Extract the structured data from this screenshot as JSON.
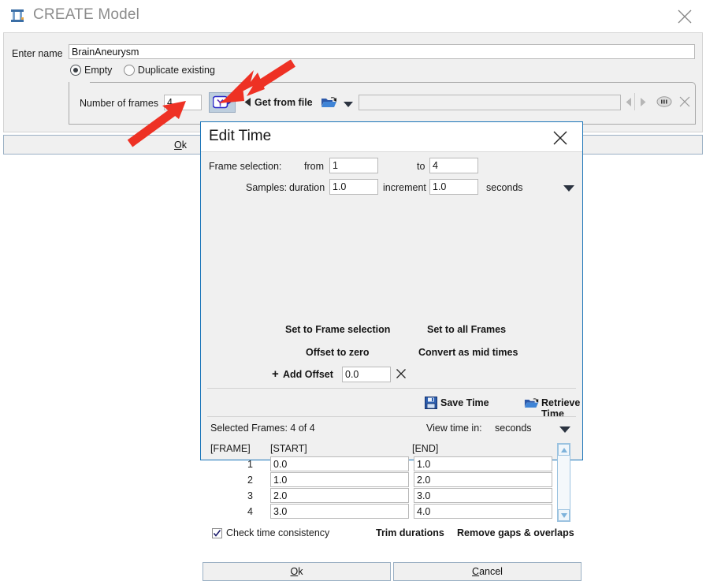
{
  "window": {
    "title": "CREATE Model",
    "icon": "app-table-icon",
    "close_icon": "close-icon"
  },
  "form": {
    "enter_name_label": "Enter name",
    "name_value": "BrainAneurysm",
    "options": [
      {
        "label": "Empty",
        "selected": true
      },
      {
        "label": "Duplicate existing",
        "selected": false
      }
    ],
    "number_of_frames_label": "Number of frames",
    "number_of_frames_value": "4",
    "time_edit_icon": "clock-edit-icon",
    "get_from_file_label": "Get from file",
    "folder_icon": "open-folder-icon",
    "dropdown_icon": "chevron-down-icon",
    "file_value": "",
    "file_placeholder": "",
    "prev_icon": "triangle-left-icon",
    "next_icon": "triangle-right-icon",
    "blob_icon": "ellipsis-button-icon",
    "clear_icon": "close-icon"
  },
  "ok_bar": {
    "label": "Ok",
    "mnemonic": "O"
  },
  "dialog": {
    "title": "Edit Time",
    "close_icon": "close-icon",
    "frame_selection_label": "Frame selection:",
    "from_label": "from",
    "from_value": "1",
    "to_label": "to",
    "to_value": "4",
    "samples_label": "Samples:",
    "duration_label": "duration",
    "duration_value": "1.0",
    "increment_label": "increment",
    "increment_value": "1.0",
    "units_label": "seconds",
    "units_caret_icon": "chevron-down-icon",
    "set_to_frame_selection": "Set to Frame selection",
    "set_to_all_frames": "Set to all Frames",
    "offset_to_zero": "Offset to zero",
    "convert_as_mid_times": "Convert as mid times",
    "add_offset_label": "Add Offset",
    "add_offset_icon": "plus-icon",
    "offset_value": "0.0",
    "offset_clear_icon": "close-icon",
    "save_time_label": "Save Time",
    "save_icon": "floppy-save-icon",
    "retrieve_time_label": "Retrieve Time",
    "retrieve_icon": "open-folder-icon",
    "selected_frames_label": "Selected Frames: 4 of 4",
    "view_time_in_label": "View time in:",
    "view_time_units": "seconds",
    "view_caret_icon": "chevron-down-icon",
    "table": {
      "headers": [
        "[FRAME]",
        "[START]",
        "[END]"
      ],
      "rows": [
        {
          "frame": "1",
          "start": "0.0",
          "end": "1.0"
        },
        {
          "frame": "2",
          "start": "1.0",
          "end": "2.0"
        },
        {
          "frame": "3",
          "start": "2.0",
          "end": "3.0"
        },
        {
          "frame": "4",
          "start": "3.0",
          "end": "4.0"
        }
      ]
    },
    "scroll_up_icon": "triangle-up-icon",
    "scroll_down_icon": "triangle-down-icon",
    "check_time_consistency_label": "Check time consistency",
    "check_time_consistency_checked": true,
    "trim_durations_label": "Trim durations",
    "remove_gaps_label": "Remove gaps & overlaps",
    "ok_label": "Ok",
    "ok_mnemonic": "O",
    "cancel_label": "Cancel",
    "cancel_mnemonic": "C"
  },
  "annotations": {
    "arrow_color": "#ee3124",
    "arrow_1_target": "clock-edit-icon",
    "arrow_2_target": "number-of-frames-input"
  }
}
